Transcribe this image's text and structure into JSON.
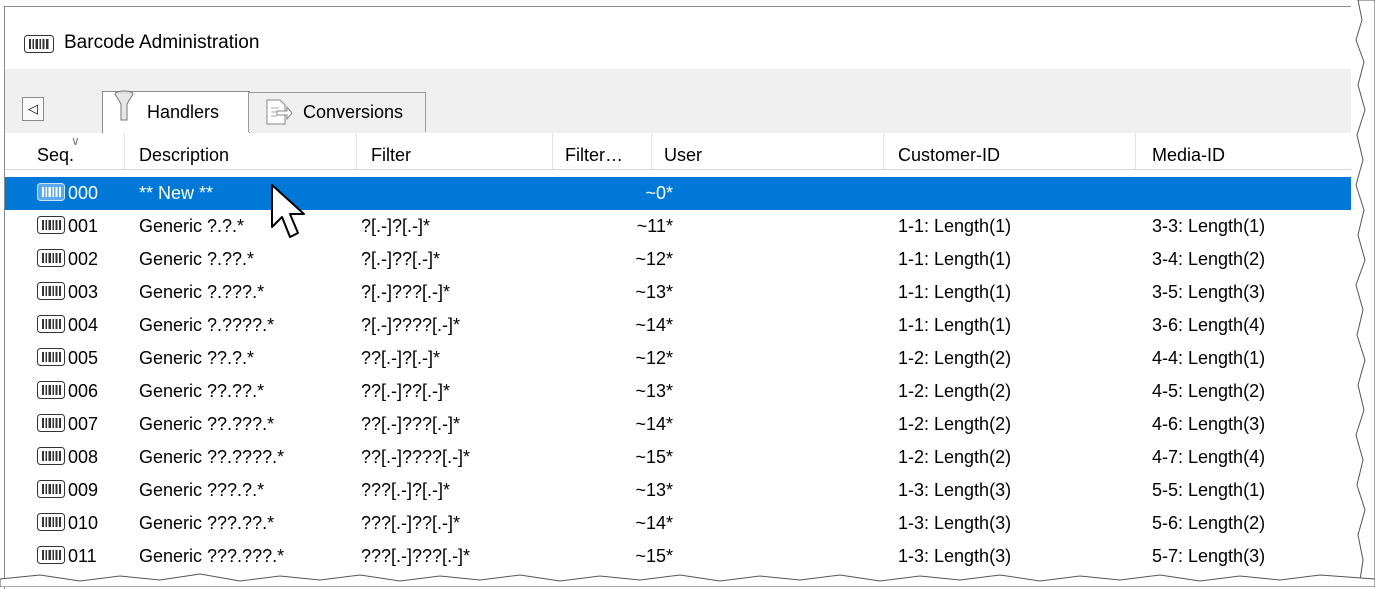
{
  "window": {
    "title": "Barcode Administration",
    "icon": "barcode-icon"
  },
  "tabs": [
    {
      "label": "Handlers",
      "icon": "funnel-icon",
      "active": true
    },
    {
      "label": "Conversions",
      "icon": "document-arrow-icon",
      "active": false
    }
  ],
  "tab_scroll_button": "◁",
  "columns": {
    "seq": "Seq.",
    "description": "Description",
    "filter": "Filter",
    "filter_length": "Filter…",
    "user": "User",
    "customer_id": "Customer-ID",
    "media_id": "Media-ID"
  },
  "rows": [
    {
      "seq": "000",
      "description": "** New **",
      "filter": "",
      "filter_length": "~0",
      "user": "*",
      "customer_id": "",
      "media_id": "",
      "selected": true
    },
    {
      "seq": "001",
      "description": "Generic ?.?.*",
      "filter": "?[.-]?[.-]*",
      "filter_length": "~11",
      "user": "*",
      "customer_id": "1-1: Length(1)",
      "media_id": "3-3: Length(1)"
    },
    {
      "seq": "002",
      "description": "Generic ?.??.*",
      "filter": "?[.-]??[.-]*",
      "filter_length": "~12",
      "user": "*",
      "customer_id": "1-1: Length(1)",
      "media_id": "3-4: Length(2)"
    },
    {
      "seq": "003",
      "description": "Generic ?.???.*",
      "filter": "?[.-]???[.-]*",
      "filter_length": "~13",
      "user": "*",
      "customer_id": "1-1: Length(1)",
      "media_id": "3-5: Length(3)"
    },
    {
      "seq": "004",
      "description": "Generic ?.????.*",
      "filter": "?[.-]????[.-]*",
      "filter_length": "~14",
      "user": "*",
      "customer_id": "1-1: Length(1)",
      "media_id": "3-6: Length(4)"
    },
    {
      "seq": "005",
      "description": "Generic ??.?.*",
      "filter": "??[.-]?[.-]*",
      "filter_length": "~12",
      "user": "*",
      "customer_id": "1-2: Length(2)",
      "media_id": "4-4: Length(1)"
    },
    {
      "seq": "006",
      "description": "Generic ??.??.*",
      "filter": "??[.-]??[.-]*",
      "filter_length": "~13",
      "user": "*",
      "customer_id": "1-2: Length(2)",
      "media_id": "4-5: Length(2)"
    },
    {
      "seq": "007",
      "description": "Generic ??.???.*",
      "filter": "??[.-]???[.-]*",
      "filter_length": "~14",
      "user": "*",
      "customer_id": "1-2: Length(2)",
      "media_id": "4-6: Length(3)"
    },
    {
      "seq": "008",
      "description": "Generic ??.????.*",
      "filter": "??[.-]????[.-]*",
      "filter_length": "~15",
      "user": "*",
      "customer_id": "1-2: Length(2)",
      "media_id": "4-7: Length(4)"
    },
    {
      "seq": "009",
      "description": "Generic ???.?.*",
      "filter": "???[.-]?[.-]*",
      "filter_length": "~13",
      "user": "*",
      "customer_id": "1-3: Length(3)",
      "media_id": "5-5: Length(1)"
    },
    {
      "seq": "010",
      "description": "Generic ???.??.*",
      "filter": "???[.-]??[.-]*",
      "filter_length": "~14",
      "user": "*",
      "customer_id": "1-3: Length(3)",
      "media_id": "5-6: Length(2)"
    },
    {
      "seq": "011",
      "description": "Generic ???.???.*",
      "filter": "???[.-]???[.-]*",
      "filter_length": "~15",
      "user": "*",
      "customer_id": "1-3: Length(3)",
      "media_id": "5-7: Length(3)"
    }
  ],
  "colors": {
    "selection": "#0078d7",
    "tab_strip": "#f0f0f0"
  }
}
